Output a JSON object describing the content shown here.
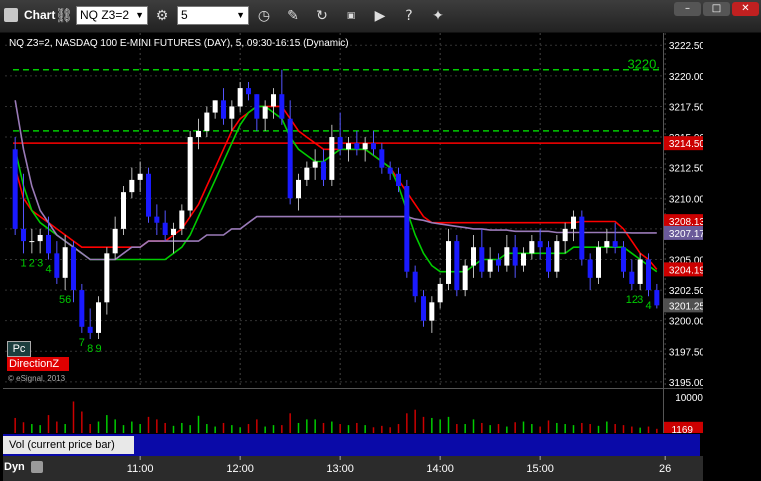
{
  "window": {
    "title": "Chart",
    "symbol_value": "NQ Z3=2",
    "interval_value": "5",
    "toolbar_icons": [
      "link-icon",
      "settings-icon",
      "interval-dropdown-icon",
      "clock-icon",
      "pencil-icon",
      "refresh-icon",
      "gif-icon",
      "play-icon",
      "help-icon",
      "pin-icon"
    ],
    "controls": [
      "minimize-icon",
      "maximize-icon",
      "close-icon"
    ]
  },
  "legend": {
    "info": "NQ Z3=2, NASDAQ 100 E-MINI FUTURES (DAY), 5, 09:30-16:15 (Dynamic)"
  },
  "overlays": {
    "pc_label": "Pc",
    "direction_label": "DirectionZ",
    "copyright": "© eSignal, 2013"
  },
  "bottom": {
    "dyn_label": "Dyn",
    "vol_label": "Vol (current price bar)"
  },
  "colors": {
    "up_candle": "#ffffff",
    "down_candle": "#1a1aff",
    "red_line": "#ff0000",
    "green_line": "#00cc00",
    "purple_line": "#9a7ab8",
    "dashed_green": "#00cc00",
    "axis_tag_red": "#cc0000",
    "axis_tag_purple": "#6a5a9a",
    "volume_up": "#00cc00",
    "volume_down": "#cc0000"
  },
  "chart_data": {
    "type": "candlestick",
    "title": "NQ Z3=2, NASDAQ 100 E-MINI FUTURES (DAY), 5, 09:30-16:15 (Dynamic)",
    "ylim": [
      3194.5,
      3223.5
    ],
    "y_ticks": [
      3195.0,
      3197.5,
      3200.0,
      3202.5,
      3205.0,
      3207.5,
      3210.0,
      3212.5,
      3215.0,
      3217.5,
      3220.0,
      3222.5
    ],
    "y_tick_labels": [
      "3195.00",
      "3197.50",
      "3200.00",
      "3202.50",
      "3205.00",
      "3207.50",
      "3210.00",
      "3212.50",
      "3215.00",
      "3217.50",
      "3220.00",
      "3222.50"
    ],
    "x_labels": [
      {
        "label": "11:00",
        "bar": 15
      },
      {
        "label": "12:00",
        "bar": 27
      },
      {
        "label": "13:00",
        "bar": 39
      },
      {
        "label": "14:00",
        "bar": 51
      },
      {
        "label": "15:00",
        "bar": 63
      },
      {
        "label": "26",
        "bar": 78
      }
    ],
    "axis_tags": [
      {
        "value": 3214.5,
        "label": "3214.50",
        "color": "#cc0000"
      },
      {
        "value": 3208.13,
        "label": "3208.13",
        "color": "#cc0000"
      },
      {
        "value": 3207.17,
        "label": "3207.17",
        "color": "#6a5a9a"
      },
      {
        "value": 3204.19,
        "label": "3204.19",
        "color": "#cc0000"
      },
      {
        "value": 3201.25,
        "label": "3201.25",
        "color": "#505050"
      }
    ],
    "level_lines": [
      {
        "value": 3220.5,
        "style": "dashed",
        "color": "#00cc00",
        "label": "3220."
      },
      {
        "value": 3215.5,
        "style": "dashed",
        "color": "#00cc00",
        "label": ""
      },
      {
        "value": 3214.5,
        "style": "solid",
        "color": "#ff0000",
        "label": ""
      }
    ],
    "candles": [
      {
        "o": 3214.0,
        "h": 3215.0,
        "l": 3207.0,
        "c": 3207.5
      },
      {
        "o": 3207.5,
        "h": 3212.0,
        "l": 3205.5,
        "c": 3206.5
      },
      {
        "o": 3206.5,
        "h": 3207.5,
        "l": 3205.5,
        "c": 3206.5
      },
      {
        "o": 3206.5,
        "h": 3207.5,
        "l": 3205.5,
        "c": 3207.0
      },
      {
        "o": 3207.0,
        "h": 3208.5,
        "l": 3205.0,
        "c": 3205.5
      },
      {
        "o": 3205.5,
        "h": 3206.5,
        "l": 3203.0,
        "c": 3203.5
      },
      {
        "o": 3203.5,
        "h": 3207.0,
        "l": 3202.5,
        "c": 3206.0
      },
      {
        "o": 3206.0,
        "h": 3206.5,
        "l": 3201.5,
        "c": 3202.5
      },
      {
        "o": 3202.5,
        "h": 3203.0,
        "l": 3199.0,
        "c": 3199.5
      },
      {
        "o": 3199.5,
        "h": 3201.0,
        "l": 3198.5,
        "c": 3199.0
      },
      {
        "o": 3199.0,
        "h": 3202.0,
        "l": 3198.5,
        "c": 3201.5
      },
      {
        "o": 3201.5,
        "h": 3206.0,
        "l": 3200.5,
        "c": 3205.5
      },
      {
        "o": 3205.5,
        "h": 3208.5,
        "l": 3205.0,
        "c": 3207.5
      },
      {
        "o": 3207.5,
        "h": 3211.0,
        "l": 3207.0,
        "c": 3210.5
      },
      {
        "o": 3210.5,
        "h": 3212.5,
        "l": 3210.0,
        "c": 3211.5
      },
      {
        "o": 3211.5,
        "h": 3213.0,
        "l": 3210.5,
        "c": 3212.0
      },
      {
        "o": 3212.0,
        "h": 3212.5,
        "l": 3208.0,
        "c": 3208.5
      },
      {
        "o": 3208.5,
        "h": 3209.5,
        "l": 3207.0,
        "c": 3208.0
      },
      {
        "o": 3208.0,
        "h": 3209.0,
        "l": 3206.5,
        "c": 3207.0
      },
      {
        "o": 3207.0,
        "h": 3208.0,
        "l": 3205.5,
        "c": 3207.5
      },
      {
        "o": 3207.5,
        "h": 3209.5,
        "l": 3207.0,
        "c": 3209.0
      },
      {
        "o": 3209.0,
        "h": 3215.5,
        "l": 3208.5,
        "c": 3215.0
      },
      {
        "o": 3215.0,
        "h": 3216.5,
        "l": 3214.0,
        "c": 3215.5
      },
      {
        "o": 3215.5,
        "h": 3217.5,
        "l": 3215.0,
        "c": 3217.0
      },
      {
        "o": 3217.0,
        "h": 3218.0,
        "l": 3216.5,
        "c": 3218.0
      },
      {
        "o": 3218.0,
        "h": 3219.0,
        "l": 3216.0,
        "c": 3216.5
      },
      {
        "o": 3216.5,
        "h": 3218.0,
        "l": 3215.5,
        "c": 3217.5
      },
      {
        "o": 3217.5,
        "h": 3219.5,
        "l": 3217.0,
        "c": 3219.0
      },
      {
        "o": 3219.0,
        "h": 3219.5,
        "l": 3218.0,
        "c": 3218.5
      },
      {
        "o": 3218.5,
        "h": 3218.5,
        "l": 3215.5,
        "c": 3216.5
      },
      {
        "o": 3216.5,
        "h": 3218.0,
        "l": 3215.5,
        "c": 3217.5
      },
      {
        "o": 3217.5,
        "h": 3219.0,
        "l": 3216.5,
        "c": 3218.5
      },
      {
        "o": 3218.5,
        "h": 3220.5,
        "l": 3216.0,
        "c": 3216.5
      },
      {
        "o": 3216.5,
        "h": 3218.0,
        "l": 3209.5,
        "c": 3210.0
      },
      {
        "o": 3210.0,
        "h": 3212.0,
        "l": 3209.0,
        "c": 3211.5
      },
      {
        "o": 3211.5,
        "h": 3213.0,
        "l": 3211.0,
        "c": 3212.5
      },
      {
        "o": 3212.5,
        "h": 3214.0,
        "l": 3211.5,
        "c": 3213.0
      },
      {
        "o": 3213.0,
        "h": 3214.0,
        "l": 3211.0,
        "c": 3211.5
      },
      {
        "o": 3211.5,
        "h": 3216.0,
        "l": 3211.0,
        "c": 3215.0
      },
      {
        "o": 3215.0,
        "h": 3217.0,
        "l": 3213.5,
        "c": 3214.0
      },
      {
        "o": 3214.0,
        "h": 3215.0,
        "l": 3213.0,
        "c": 3214.5
      },
      {
        "o": 3214.5,
        "h": 3215.5,
        "l": 3213.5,
        "c": 3214.0
      },
      {
        "o": 3214.0,
        "h": 3215.0,
        "l": 3213.0,
        "c": 3214.5
      },
      {
        "o": 3214.5,
        "h": 3215.5,
        "l": 3213.5,
        "c": 3214.0
      },
      {
        "o": 3214.0,
        "h": 3214.5,
        "l": 3212.0,
        "c": 3212.5
      },
      {
        "o": 3212.5,
        "h": 3213.0,
        "l": 3211.5,
        "c": 3212.0
      },
      {
        "o": 3212.0,
        "h": 3212.5,
        "l": 3210.5,
        "c": 3211.0
      },
      {
        "o": 3211.0,
        "h": 3211.5,
        "l": 3203.5,
        "c": 3204.0
      },
      {
        "o": 3204.0,
        "h": 3204.5,
        "l": 3201.5,
        "c": 3202.0
      },
      {
        "o": 3202.0,
        "h": 3202.5,
        "l": 3199.5,
        "c": 3200.0
      },
      {
        "o": 3200.0,
        "h": 3202.0,
        "l": 3199.0,
        "c": 3201.5
      },
      {
        "o": 3201.5,
        "h": 3203.5,
        "l": 3201.0,
        "c": 3203.0
      },
      {
        "o": 3203.0,
        "h": 3207.5,
        "l": 3202.5,
        "c": 3206.5
      },
      {
        "o": 3206.5,
        "h": 3207.0,
        "l": 3202.0,
        "c": 3202.5
      },
      {
        "o": 3202.5,
        "h": 3205.0,
        "l": 3202.0,
        "c": 3204.5
      },
      {
        "o": 3204.5,
        "h": 3207.0,
        "l": 3203.5,
        "c": 3206.0
      },
      {
        "o": 3206.0,
        "h": 3207.5,
        "l": 3203.5,
        "c": 3204.0
      },
      {
        "o": 3204.0,
        "h": 3206.0,
        "l": 3203.5,
        "c": 3205.0
      },
      {
        "o": 3205.0,
        "h": 3205.5,
        "l": 3204.0,
        "c": 3204.5
      },
      {
        "o": 3204.5,
        "h": 3207.0,
        "l": 3204.0,
        "c": 3206.0
      },
      {
        "o": 3206.0,
        "h": 3207.0,
        "l": 3203.5,
        "c": 3204.5
      },
      {
        "o": 3204.5,
        "h": 3206.0,
        "l": 3204.0,
        "c": 3205.5
      },
      {
        "o": 3205.5,
        "h": 3207.0,
        "l": 3205.0,
        "c": 3206.5
      },
      {
        "o": 3206.5,
        "h": 3207.5,
        "l": 3205.0,
        "c": 3206.0
      },
      {
        "o": 3206.0,
        "h": 3206.5,
        "l": 3203.5,
        "c": 3204.0
      },
      {
        "o": 3204.0,
        "h": 3207.0,
        "l": 3203.5,
        "c": 3206.5
      },
      {
        "o": 3206.5,
        "h": 3208.0,
        "l": 3205.5,
        "c": 3207.5
      },
      {
        "o": 3207.5,
        "h": 3209.0,
        "l": 3206.5,
        "c": 3208.5
      },
      {
        "o": 3208.5,
        "h": 3209.0,
        "l": 3204.5,
        "c": 3205.0
      },
      {
        "o": 3205.0,
        "h": 3205.5,
        "l": 3202.5,
        "c": 3203.5
      },
      {
        "o": 3203.5,
        "h": 3206.5,
        "l": 3203.0,
        "c": 3206.0
      },
      {
        "o": 3206.0,
        "h": 3207.5,
        "l": 3205.5,
        "c": 3206.5
      },
      {
        "o": 3206.5,
        "h": 3208.0,
        "l": 3205.5,
        "c": 3206.0
      },
      {
        "o": 3206.0,
        "h": 3206.5,
        "l": 3203.5,
        "c": 3204.0
      },
      {
        "o": 3204.0,
        "h": 3205.0,
        "l": 3202.5,
        "c": 3203.0
      },
      {
        "o": 3203.0,
        "h": 3205.5,
        "l": 3202.5,
        "c": 3205.0
      },
      {
        "o": 3205.0,
        "h": 3205.5,
        "l": 3202.0,
        "c": 3202.5
      },
      {
        "o": 3202.5,
        "h": 3203.0,
        "l": 3201.0,
        "c": 3201.25
      }
    ],
    "series": [
      {
        "name": "",
        "color": "#ff0000",
        "values": [
          3212.5,
          3210.0,
          3209.0,
          3208.5,
          3208.0,
          3207.5,
          3207.0,
          3206.5,
          3206.0,
          3206.0,
          3206.0,
          3206.0,
          3206.0,
          3206.0,
          3206.0,
          3206.0,
          3206.5,
          3206.5,
          3206.5,
          3207.0,
          3207.5,
          3208.5,
          3209.5,
          3211.0,
          3212.5,
          3214.0,
          3215.5,
          3216.5,
          3217.0,
          3217.5,
          3217.5,
          3217.5,
          3217.5,
          3216.5,
          3215.5,
          3215.0,
          3214.5,
          3214.0,
          3214.0,
          3214.0,
          3214.0,
          3214.0,
          3214.0,
          3213.5,
          3213.0,
          3212.5,
          3211.5,
          3210.5,
          3209.5,
          3208.5,
          3208.0,
          3208.0,
          3208.0,
          3208.0,
          3208.0,
          3208.0,
          3208.0,
          3208.0,
          3208.0,
          3208.0,
          3208.0,
          3208.0,
          3208.0,
          3208.0,
          3208.0,
          3208.0,
          3208.0,
          3208.0,
          3208.1,
          3208.1,
          3208.1,
          3208.1,
          3208.1,
          3207.5,
          3206.5,
          3205.5,
          3205.0,
          3204.19
        ]
      },
      {
        "name": "",
        "color": "#00cc00",
        "values": [
          3214.0,
          3211.0,
          3209.0,
          3208.0,
          3207.5,
          3207.0,
          3206.5,
          3206.0,
          3205.5,
          3205.0,
          3205.0,
          3205.0,
          3205.0,
          3205.0,
          3205.0,
          3205.0,
          3205.0,
          3205.0,
          3205.0,
          3205.5,
          3206.0,
          3207.0,
          3208.5,
          3210.0,
          3211.5,
          3213.0,
          3214.5,
          3216.0,
          3217.0,
          3217.5,
          3217.5,
          3217.0,
          3216.5,
          3215.0,
          3214.0,
          3213.5,
          3213.0,
          3213.0,
          3213.5,
          3214.0,
          3214.0,
          3214.0,
          3214.0,
          3213.5,
          3213.0,
          3212.5,
          3211.0,
          3209.0,
          3207.0,
          3205.5,
          3204.5,
          3204.0,
          3204.0,
          3204.0,
          3204.0,
          3204.5,
          3205.0,
          3205.0,
          3205.0,
          3205.5,
          3205.5,
          3205.5,
          3205.5,
          3205.5,
          3205.5,
          3205.5,
          3205.5,
          3206.0,
          3206.0,
          3206.0,
          3206.0,
          3206.0,
          3206.0,
          3206.0,
          3205.5,
          3205.0,
          3204.5,
          3204.0
        ]
      },
      {
        "name": "",
        "color": "#9a7ab8",
        "values": [
          3218.0,
          3214.0,
          3211.0,
          3209.0,
          3208.0,
          3207.0,
          3206.5,
          3206.0,
          3205.5,
          3205.0,
          3205.0,
          3205.0,
          3205.0,
          3205.5,
          3206.0,
          3206.0,
          3206.5,
          3206.5,
          3206.5,
          3206.5,
          3206.5,
          3206.5,
          3206.5,
          3207.0,
          3207.0,
          3207.0,
          3207.5,
          3207.5,
          3208.0,
          3208.5,
          3208.5,
          3208.5,
          3208.5,
          3208.5,
          3208.5,
          3208.5,
          3208.5,
          3208.5,
          3208.5,
          3208.5,
          3208.5,
          3208.5,
          3208.5,
          3208.5,
          3208.5,
          3208.5,
          3208.5,
          3208.5,
          3208.3,
          3208.2,
          3208.0,
          3207.9,
          3207.8,
          3207.7,
          3207.6,
          3207.5,
          3207.5,
          3207.4,
          3207.4,
          3207.4,
          3207.3,
          3207.3,
          3207.3,
          3207.3,
          3207.3,
          3207.2,
          3207.2,
          3207.2,
          3207.2,
          3207.2,
          3207.2,
          3207.2,
          3207.2,
          3207.2,
          3207.17,
          3207.17,
          3207.17,
          3207.17
        ]
      }
    ],
    "bar_labels": [
      {
        "bar": 1,
        "text": "1",
        "position": "below"
      },
      {
        "bar": 2,
        "text": "2",
        "position": "below"
      },
      {
        "bar": 3,
        "text": "3",
        "position": "below"
      },
      {
        "bar": 4,
        "text": "4",
        "position": "below"
      },
      {
        "bar": 6,
        "text": "56",
        "position": "below"
      },
      {
        "bar": 8,
        "text": "7",
        "position": "below"
      },
      {
        "bar": 9,
        "text": "8",
        "position": "below"
      },
      {
        "bar": 10,
        "text": "9",
        "position": "below"
      },
      {
        "bar": 74,
        "text": "12",
        "position": "below"
      },
      {
        "bar": 75,
        "text": "3",
        "position": "below"
      },
      {
        "bar": 76,
        "text": "4",
        "position": "below"
      }
    ],
    "volume": {
      "y_ticks": [
        10000
      ],
      "y_tick_labels": [
        "10000"
      ],
      "current_label": "1169",
      "ylim": [
        0,
        12000
      ],
      "values": [
        4200,
        3000,
        2500,
        2200,
        5000,
        3200,
        2500,
        8800,
        6000,
        2500,
        3200,
        5000,
        3800,
        2200,
        3200,
        2500,
        4500,
        3800,
        2800,
        2000,
        2800,
        2200,
        4800,
        2500,
        1800,
        2800,
        2200,
        1600,
        2500,
        3800,
        1800,
        2200,
        2200,
        5500,
        2800,
        3800,
        3800,
        2800,
        3200,
        2500,
        2200,
        2800,
        2200,
        1600,
        2000,
        1600,
        2500,
        5500,
        6500,
        4500,
        4200,
        3800,
        4500,
        2500,
        2500,
        3800,
        2800,
        2200,
        2500,
        1800,
        3000,
        3200,
        2500,
        1800,
        3500,
        2800,
        2500,
        2200,
        2800,
        2500,
        2000,
        3200,
        2500,
        2200,
        1800,
        1500,
        1800,
        1169
      ]
    }
  }
}
